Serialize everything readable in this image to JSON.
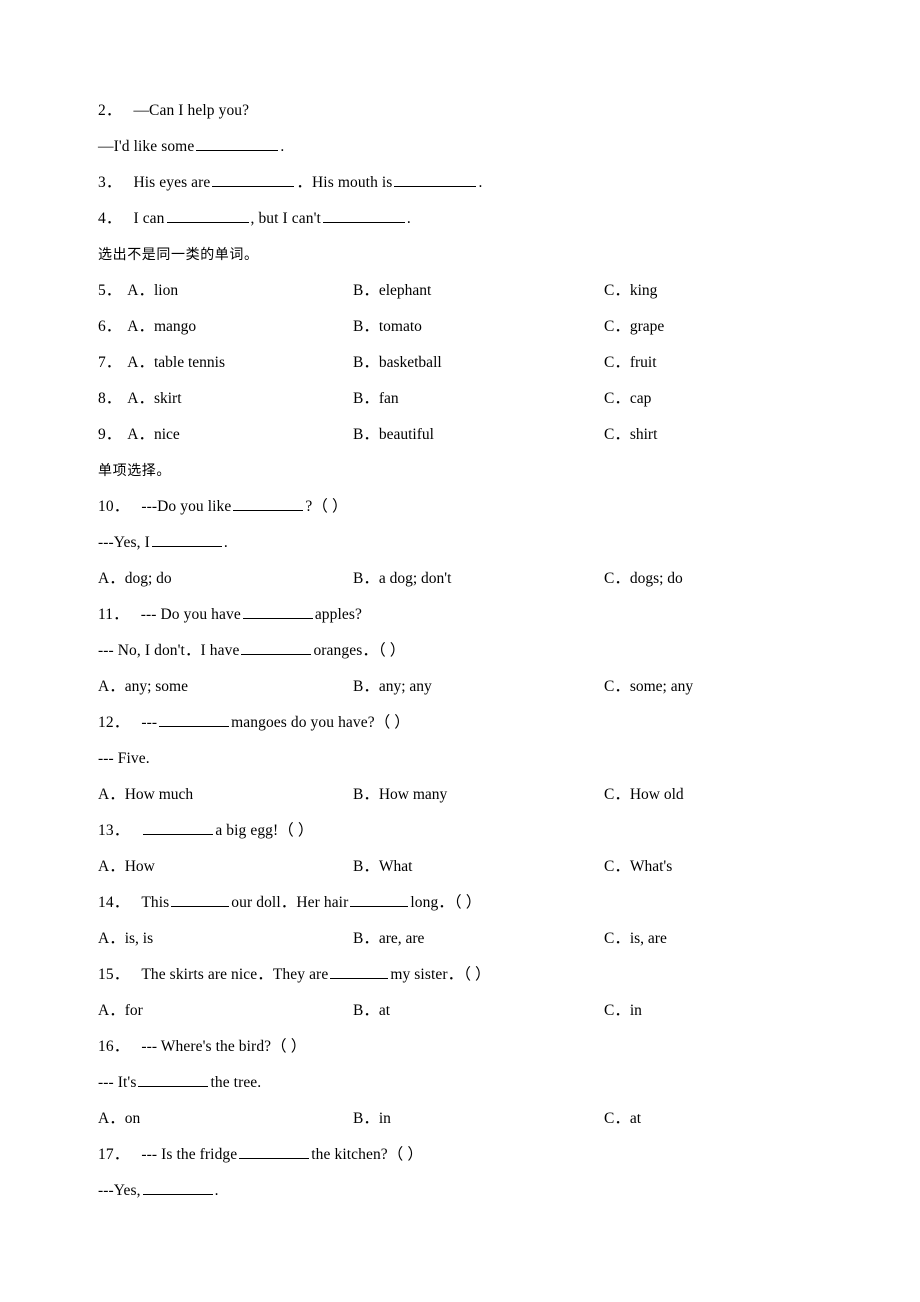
{
  "document": {
    "type": "english-exercise-worksheet",
    "language": "en-zh"
  },
  "items": [
    {
      "id": "q2-line1",
      "kind": "fill-in-question",
      "number": "2．",
      "text": "—Can I help you?"
    },
    {
      "id": "q2-line2",
      "kind": "fill-in-answer",
      "text_before": "—I'd like some",
      "text_after": "."
    },
    {
      "id": "q3",
      "kind": "fill-in-question",
      "number": "3．",
      "text_a": "His eyes are",
      "text_b": "．His mouth is",
      "text_c": "."
    },
    {
      "id": "q4",
      "kind": "fill-in-question",
      "number": "4．",
      "text_a": "I can",
      "text_b": ", but I can't",
      "text_c": "."
    }
  ],
  "section_headings": {
    "odd_one_out": "选出不是同一类的单词。",
    "multiple_choice": "单项选择。"
  },
  "odd_one_out_questions": [
    {
      "number": "5．",
      "a": "A．lion",
      "b": "B．elephant",
      "c": "C．king"
    },
    {
      "number": "6．",
      "a": "A．mango",
      "b": "B．tomato",
      "c": "C．grape"
    },
    {
      "number": "7．",
      "a": "A．table tennis",
      "b": "B．basketball",
      "c": "C．fruit"
    },
    {
      "number": "8．",
      "a": "A．skirt",
      "b": "B．fan",
      "c": "C．cap"
    },
    {
      "number": "9．",
      "a": "A．nice",
      "b": "B．beautiful",
      "c": "C．shirt"
    }
  ],
  "multiple_choice_questions": [
    {
      "number": "10．",
      "stem_before": "---Do you like",
      "stem_after": "?（    ）",
      "answer_before": "---Yes, I",
      "answer_after": ".",
      "options": {
        "a": "A．dog; do",
        "b": "B．a dog; don't",
        "c": "C．dogs; do"
      }
    },
    {
      "number": "11．",
      "stem_before": "--- Do you have",
      "stem_after": "apples?",
      "answer_before": "--- No, I don't．I have",
      "answer_after": "oranges．（    ）",
      "options": {
        "a": "A．any; some",
        "b": "B．any; any",
        "c": "C．some; any"
      }
    },
    {
      "number": "12．",
      "stem_before": "---",
      "stem_after": "mangoes do you have?（    ）",
      "answer_before": "--- Five.",
      "answer_after": "",
      "options": {
        "a": "A．How much",
        "b": "B．How many",
        "c": "C．How old"
      }
    },
    {
      "number": "13．",
      "stem_before": "",
      "stem_after": "a big egg!（    ）",
      "options": {
        "a": "A．How",
        "b": "B．What",
        "c": "C．What's"
      }
    },
    {
      "number": "14．",
      "stem_before": "This",
      "stem_mid": "our doll．Her hair",
      "stem_after": "long．（    ）",
      "options": {
        "a": "A．is, is",
        "b": "B．are, are",
        "c": "C．is, are"
      }
    },
    {
      "number": "15．",
      "stem_before": "The skirts are nice．They are",
      "stem_after": "my sister．（    ）",
      "options": {
        "a": "A．for",
        "b": "B．at",
        "c": "C．in"
      }
    },
    {
      "number": "16．",
      "stem_before": "--- Where's the bird?（    ）",
      "answer_before": "--- It's",
      "answer_after": "the tree.",
      "options": {
        "a": "A．on",
        "b": "B．in",
        "c": "C．at"
      }
    },
    {
      "number": "17．",
      "stem_before": "--- Is the fridge",
      "stem_after": "the kitchen?（    ）",
      "answer_before": "---Yes,",
      "answer_after": "."
    }
  ]
}
